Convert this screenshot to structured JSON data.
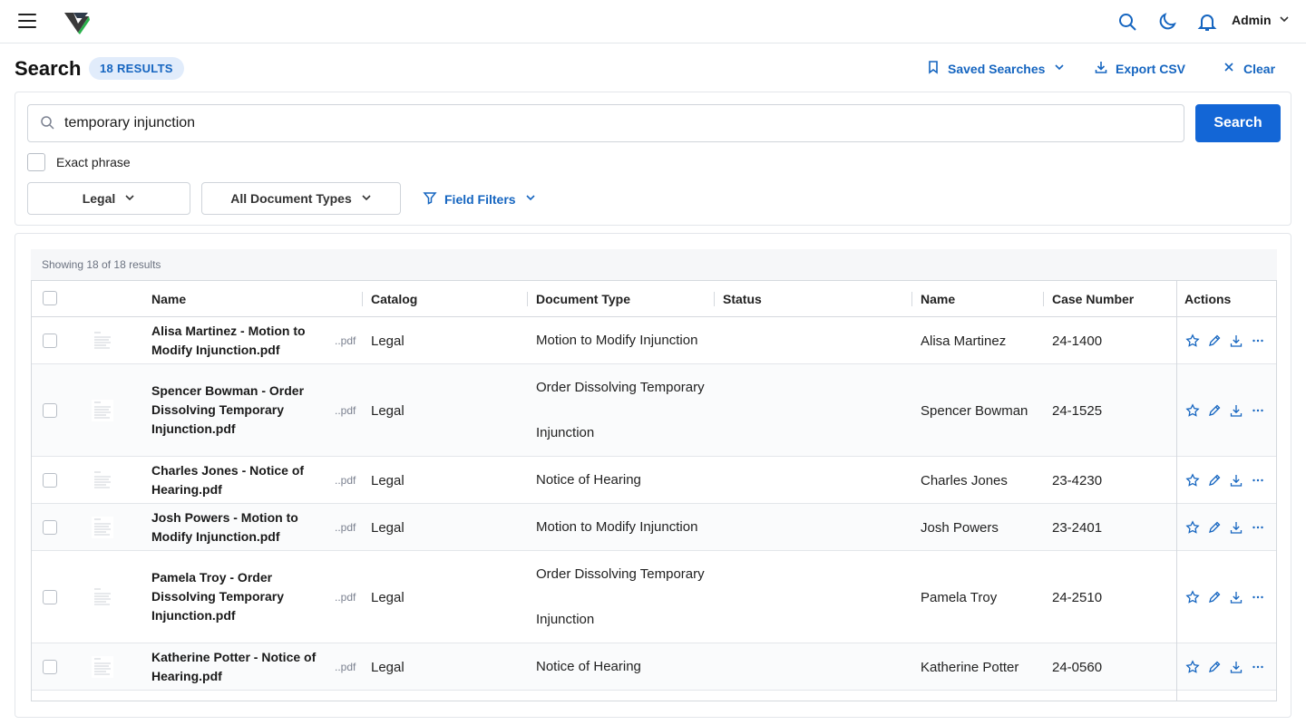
{
  "topbar": {
    "user": "Admin",
    "icons": [
      "menu-icon",
      "app-logo",
      "search-icon",
      "moon-icon",
      "bell-icon",
      "chevron-down-icon"
    ]
  },
  "header": {
    "title": "Search",
    "badge": "18 RESULTS",
    "saved_searches": "Saved Searches",
    "export_csv": "Export CSV",
    "clear": "Clear"
  },
  "search": {
    "query": "temporary injunction",
    "button": "Search",
    "exact_phrase": "Exact phrase",
    "catalog_filter": "Legal",
    "doctype_filter": "All Document Types",
    "field_filters": "Field Filters"
  },
  "results": {
    "showing": "Showing 18 of 18 results",
    "columns": [
      "Name",
      "Catalog",
      "Document Type",
      "Status",
      "Name",
      "Case Number",
      "Actions"
    ],
    "rows": [
      {
        "name": "Alisa Martinez - Motion to Modify Injunction.pdf",
        "ext": "..pdf",
        "catalog": "Legal",
        "doctype": "Motion to Modify Injunction",
        "status": "",
        "person": "Alisa Martinez",
        "case": "24-1400"
      },
      {
        "name": "Spencer Bowman - Order Dissolving Temporary Injunction.pdf",
        "ext": "..pdf",
        "catalog": "Legal",
        "doctype": "Order Dissolving Temporary Injunction",
        "status": "",
        "person": "Spencer Bowman",
        "case": "24-1525"
      },
      {
        "name": "Charles Jones - Notice of Hearing.pdf",
        "ext": "..pdf",
        "catalog": "Legal",
        "doctype": "Notice of Hearing",
        "status": "",
        "person": "Charles Jones",
        "case": "23-4230"
      },
      {
        "name": "Josh Powers - Motion to Modify Injunction.pdf",
        "ext": "..pdf",
        "catalog": "Legal",
        "doctype": "Motion to Modify Injunction",
        "status": "",
        "person": "Josh Powers",
        "case": "23-2401"
      },
      {
        "name": "Pamela Troy - Order Dissolving Temporary Injunction.pdf",
        "ext": "..pdf",
        "catalog": "Legal",
        "doctype": "Order Dissolving Temporary Injunction",
        "status": "",
        "person": "Pamela Troy",
        "case": "24-2510"
      },
      {
        "name": "Katherine Potter - Notice of Hearing.pdf",
        "ext": "..pdf",
        "catalog": "Legal",
        "doctype": "Notice of Hearing",
        "status": "",
        "person": "Katherine Potter",
        "case": "24-0560"
      }
    ]
  },
  "colors": {
    "accent": "#1366d6",
    "link": "#1565c0",
    "badge_bg": "#e1ecfb",
    "border": "#e3e6ea"
  }
}
